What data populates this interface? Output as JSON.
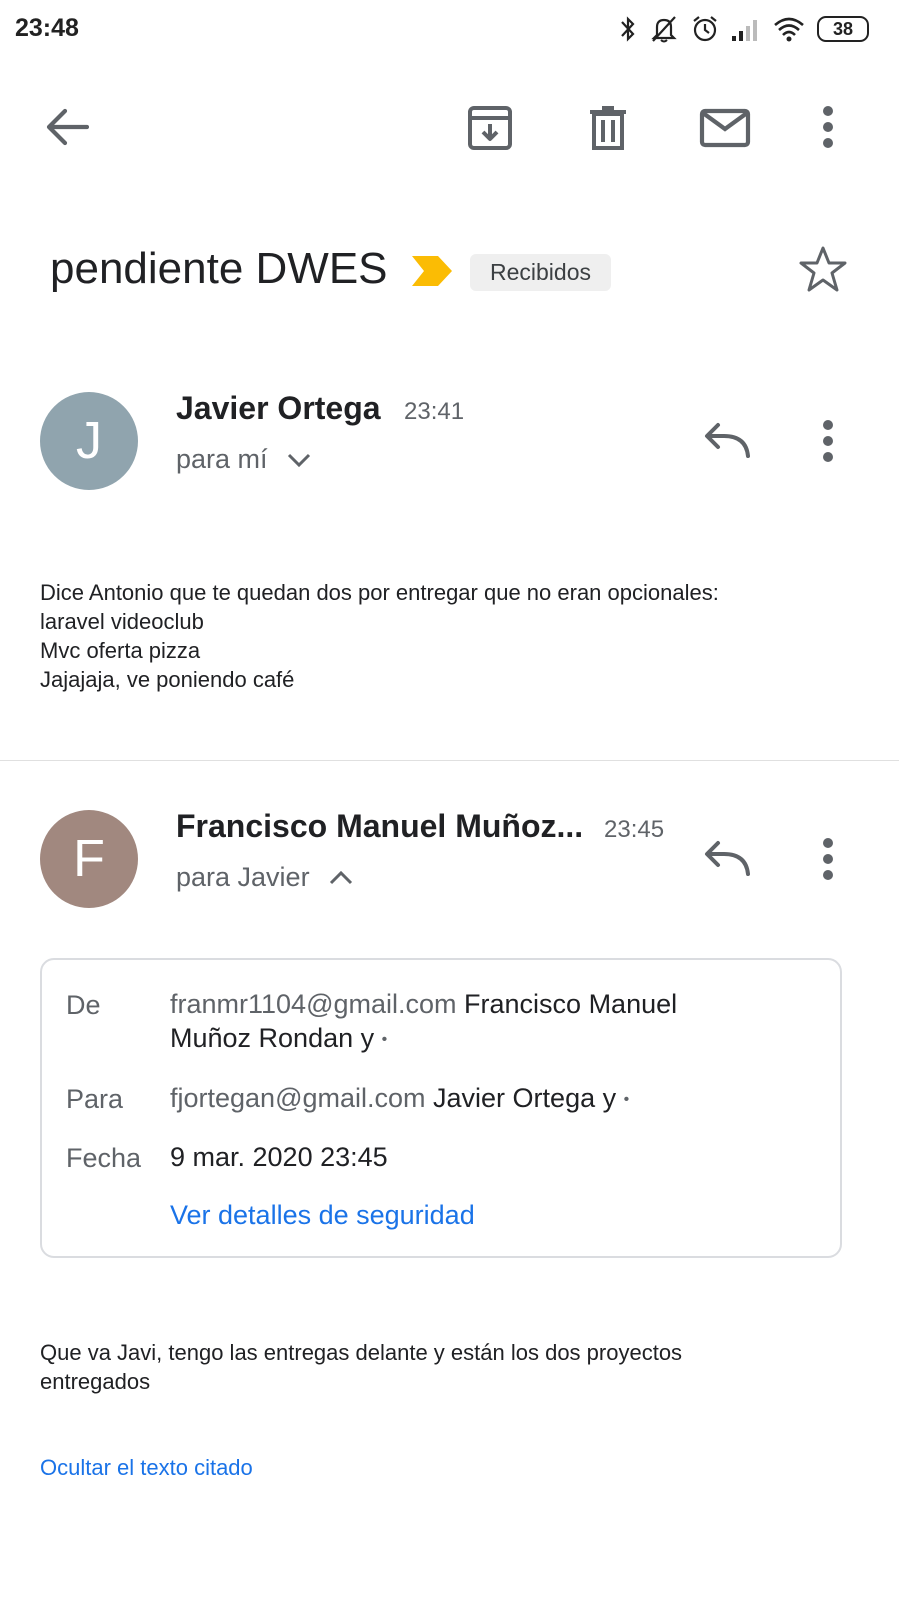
{
  "status_bar": {
    "time": "23:48",
    "battery": "38",
    "icons": [
      "bluetooth-icon",
      "mute-icon",
      "alarm-icon",
      "signal-icon",
      "wifi-icon",
      "battery-icon"
    ]
  },
  "toolbar": {
    "icons": [
      "back-arrow-icon",
      "archive-icon",
      "delete-icon",
      "mark-unread-icon",
      "more-vert-icon"
    ]
  },
  "subject": {
    "text": "pendiente DWES",
    "label": "Recibidos",
    "label_arrow_color": "#fbbc04"
  },
  "messages": [
    {
      "avatar_letter": "J",
      "avatar_color": "#90a4ae",
      "sender": "Javier Ortega",
      "time": "23:41",
      "recipient": "para mí",
      "body": [
        "Dice Antonio que te quedan dos por entregar que no eran opcionales:",
        "laravel videoclub",
        "Mvc oferta pizza",
        "Jajajaja, ve poniendo café"
      ]
    },
    {
      "avatar_letter": "F",
      "avatar_color": "#a1887f",
      "sender": "Francisco Manuel Muñoz...",
      "time": "23:45",
      "recipient": "para Javier",
      "details": {
        "from_label": "De",
        "from_email": "franmr1104@gmail.com",
        "from_name": "Francisco Manuel",
        "from_name_line2": "Muñoz Rondan y",
        "to_label": "Para",
        "to_email": "fjortegan@gmail.com",
        "to_name": "Javier Ortega y",
        "date_label": "Fecha",
        "date": "9 mar. 2020 23:45",
        "security_link": "Ver detalles de seguridad"
      },
      "body": [
        "Que va Javi, tengo las entregas delante y están los dos proyectos",
        "entregados"
      ],
      "hide_quoted": "Ocultar el texto citado"
    }
  ]
}
